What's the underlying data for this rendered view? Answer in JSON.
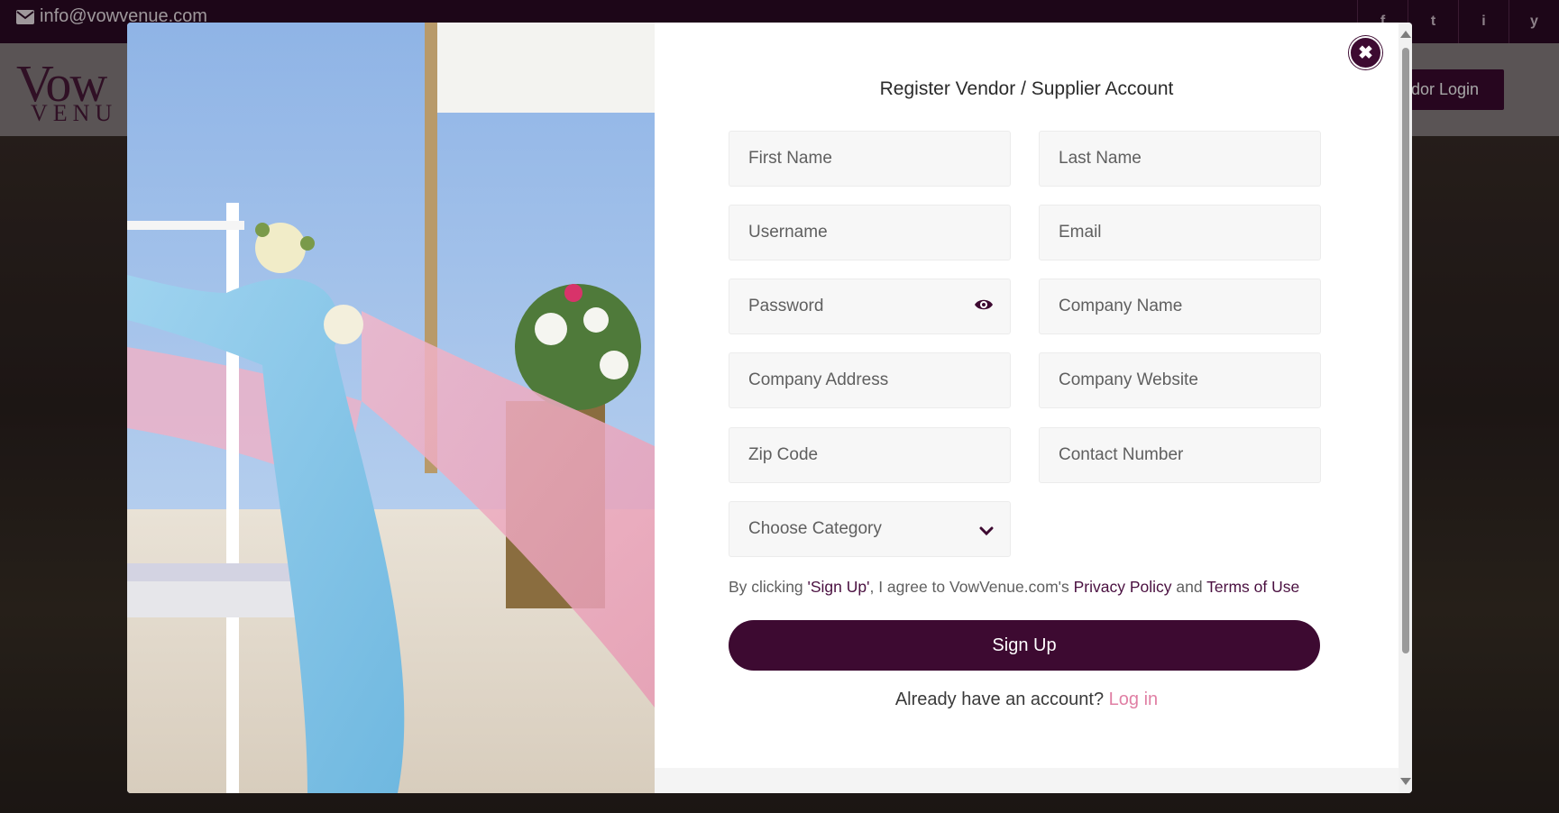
{
  "topbar": {
    "email": "info@vowvenue.com",
    "social": [
      "f",
      "t",
      "i",
      "y"
    ]
  },
  "header": {
    "logo_big": "Vow",
    "logo_small": "VENU",
    "vendor_login": "dor Login"
  },
  "modal": {
    "title": "Register Vendor / Supplier Account",
    "close_label": "✖",
    "fields": {
      "first_name": "First Name",
      "last_name": "Last Name",
      "username": "Username",
      "email": "Email",
      "password": "Password",
      "company_name": "Company Name",
      "company_address": "Company Address",
      "company_website": "Company Website",
      "zip_code": "Zip Code",
      "contact_number": "Contact Number",
      "category": "Choose Category"
    },
    "terms": {
      "prefix": "By clicking ",
      "signup_quote": "'Sign Up'",
      "middle": ", I agree to VowVenue.com's ",
      "privacy": "Privacy Policy",
      "and": " and ",
      "terms": "Terms of Use"
    },
    "signup_label": "Sign Up",
    "login_prompt": "Already have an account?",
    "login_link": "Log in"
  },
  "colors": {
    "brand": "#3d0a31",
    "link_pink": "#e07fa4",
    "field_bg": "#f7f7f7"
  },
  "icons": {
    "eye": "eye-icon",
    "chevron": "chevron-down-icon",
    "close": "close-icon",
    "envelope": "envelope-icon"
  }
}
